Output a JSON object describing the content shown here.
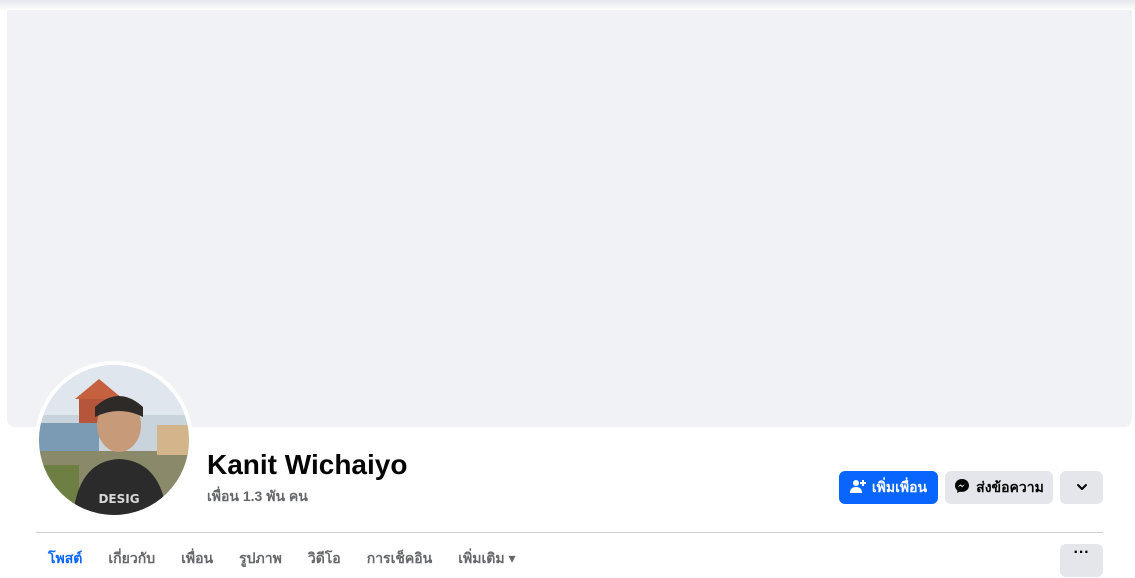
{
  "profile": {
    "name": "Kanit Wichaiyo",
    "friends_count": "เพื่อน 1.3 พัน คน"
  },
  "actions": {
    "add_friend": "เพิ่มเพื่อน",
    "message": "ส่งข้อความ",
    "more_icon": "chevron-down-icon"
  },
  "tabs": [
    {
      "label": "โพสต์",
      "active": true
    },
    {
      "label": "เกี่ยวกับ",
      "active": false
    },
    {
      "label": "เพื่อน",
      "active": false
    },
    {
      "label": "รูปภาพ",
      "active": false
    },
    {
      "label": "วิดีโอ",
      "active": false
    },
    {
      "label": "การเช็คอิน",
      "active": false
    },
    {
      "label": "เพิ่มเติม ▾",
      "active": false
    }
  ],
  "tabs_more": "···",
  "colors": {
    "primary": "#0866ff",
    "secondary_button": "#e4e6eb",
    "cover": "#f0f2f5",
    "muted_text": "#65676b"
  }
}
